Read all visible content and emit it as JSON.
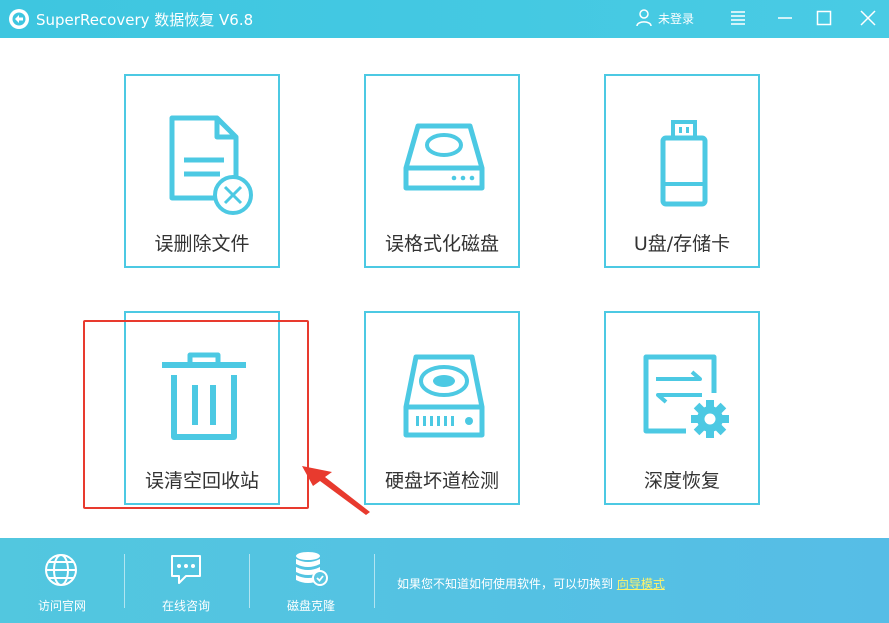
{
  "titlebar": {
    "app_title": "SuperRecovery 数据恢复 V6.8",
    "user_label": "未登录"
  },
  "tiles": [
    {
      "label": "误删除文件",
      "icon": "deleted-file-icon"
    },
    {
      "label": "误格式化磁盘",
      "icon": "formatted-disk-icon"
    },
    {
      "label": "U盘/存储卡",
      "icon": "usb-drive-icon"
    },
    {
      "label": "误清空回收站",
      "icon": "trash-bin-icon"
    },
    {
      "label": "硬盘坏道检测",
      "icon": "hard-disk-icon"
    },
    {
      "label": "深度恢复",
      "icon": "deep-recovery-icon"
    }
  ],
  "footer": {
    "items": [
      {
        "label": "访问官网",
        "icon": "globe-icon"
      },
      {
        "label": "在线咨询",
        "icon": "chat-icon"
      },
      {
        "label": "磁盘克隆",
        "icon": "database-icon"
      }
    ],
    "hint_text": "如果您不知道如何使用软件，可以切换到",
    "guide_link": "向导模式"
  },
  "colors": {
    "accent": "#4cc9e3",
    "highlight": "#e83a2e",
    "link": "#fff36a"
  }
}
